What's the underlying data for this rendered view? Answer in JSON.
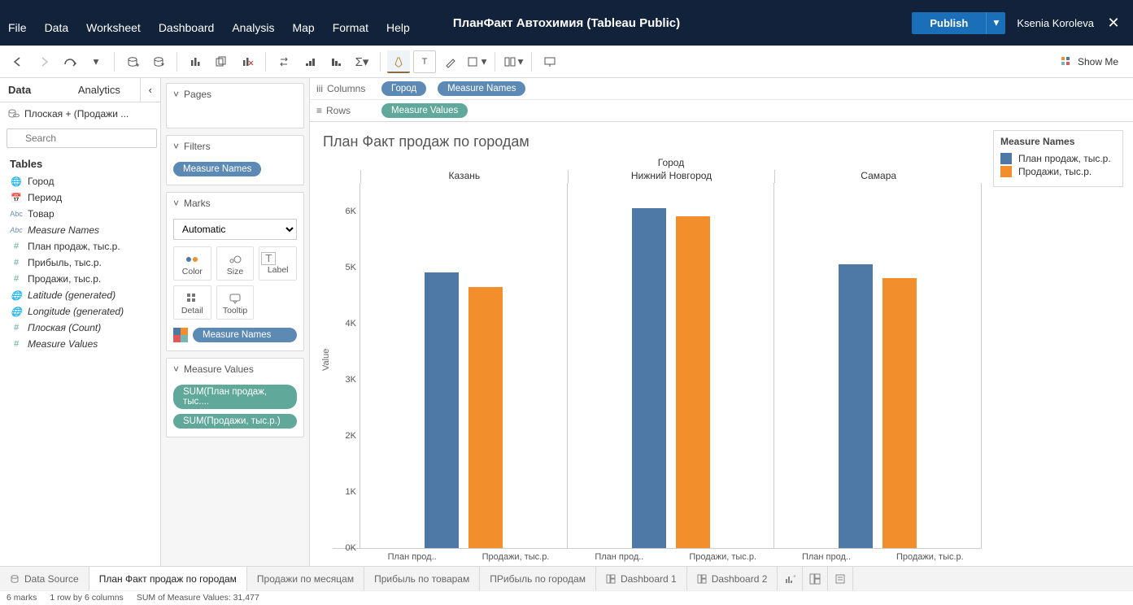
{
  "titlebar": {
    "title": "ПланФакт Автохимия (Tableau Public)",
    "publish": "Publish",
    "user": "Ksenia Koroleva"
  },
  "menu": [
    "File",
    "Data",
    "Worksheet",
    "Dashboard",
    "Analysis",
    "Map",
    "Format",
    "Help"
  ],
  "showme_label": "Show Me",
  "data_panel": {
    "tab_data": "Data",
    "tab_analytics": "Analytics",
    "source": "Плоская + (Продажи ...",
    "search_placeholder": "Search",
    "tables_label": "Tables",
    "fields": [
      {
        "icon": "globe",
        "name": "Город"
      },
      {
        "icon": "date",
        "name": "Период"
      },
      {
        "icon": "abc",
        "name": "Товар"
      },
      {
        "icon": "abc",
        "name": "Measure Names",
        "italic": true
      },
      {
        "icon": "hash",
        "name": "План продаж, тыс.р."
      },
      {
        "icon": "hash",
        "name": "Прибыль,  тыс.р."
      },
      {
        "icon": "hash",
        "name": "Продажи,  тыс.р."
      },
      {
        "icon": "globe",
        "name": "Latitude (generated)",
        "italic": true
      },
      {
        "icon": "globe",
        "name": "Longitude (generated)",
        "italic": true
      },
      {
        "icon": "hash",
        "name": "Плоская  (Count)",
        "italic": true
      },
      {
        "icon": "hash",
        "name": "Measure Values",
        "italic": true
      }
    ]
  },
  "cards": {
    "pages": "Pages",
    "filters": "Filters",
    "filters_pill": "Measure Names",
    "marks": "Marks",
    "marks_type": "Automatic",
    "cells": {
      "color": "Color",
      "size": "Size",
      "label": "Label",
      "detail": "Detail",
      "tooltip": "Tooltip"
    },
    "marks_color_pill": "Measure Names",
    "measure_values": "Measure Values",
    "mv_pills": [
      "SUM(План продаж, тыс....",
      "SUM(Продажи,  тыс.р.)"
    ]
  },
  "shelves": {
    "columns_label": "Columns",
    "rows_label": "Rows",
    "columns": [
      {
        "label": "Город",
        "color": "blue"
      },
      {
        "label": "Measure Names",
        "color": "blue"
      }
    ],
    "rows": [
      {
        "label": "Measure Values",
        "color": "green"
      }
    ]
  },
  "viz": {
    "title": "План Факт продаж по городам",
    "super_header": "Город",
    "yaxis_label": "Value",
    "legend_title": "Measure Names",
    "legend_items": [
      {
        "label": "План продаж, тыс.р.",
        "color": "#4e79a7"
      },
      {
        "label": "Продажи, тыс.р.",
        "color": "#f28e2b"
      }
    ],
    "xsub_labels": [
      "План прод..",
      "Продажи, тыс.р."
    ]
  },
  "chart_data": {
    "type": "bar",
    "categories": [
      "Казань",
      "Нижний Новгород",
      "Самара"
    ],
    "series": [
      {
        "name": "План продаж, тыс.р.",
        "values": [
          4900,
          6050,
          5050
        ]
      },
      {
        "name": "Продажи, тыс.р.",
        "values": [
          4650,
          5900,
          4800
        ]
      }
    ],
    "ylim": [
      0,
      6500
    ],
    "y_ticks": [
      "0K",
      "1K",
      "2K",
      "3K",
      "4K",
      "5K",
      "6K"
    ],
    "xlabel": "Город",
    "ylabel": "Value"
  },
  "sheets": {
    "data_source": "Data Source",
    "tabs": [
      "План Факт продаж по городам",
      "Продажи по месяцам",
      "Прибыль по товарам",
      "ПРибыль по городам",
      "Dashboard 1",
      "Dashboard 2"
    ],
    "active_index": 0
  },
  "status": {
    "marks": "6 marks",
    "rowcol": "1 row by 6 columns",
    "sum": "SUM of Measure Values: 31,477"
  }
}
